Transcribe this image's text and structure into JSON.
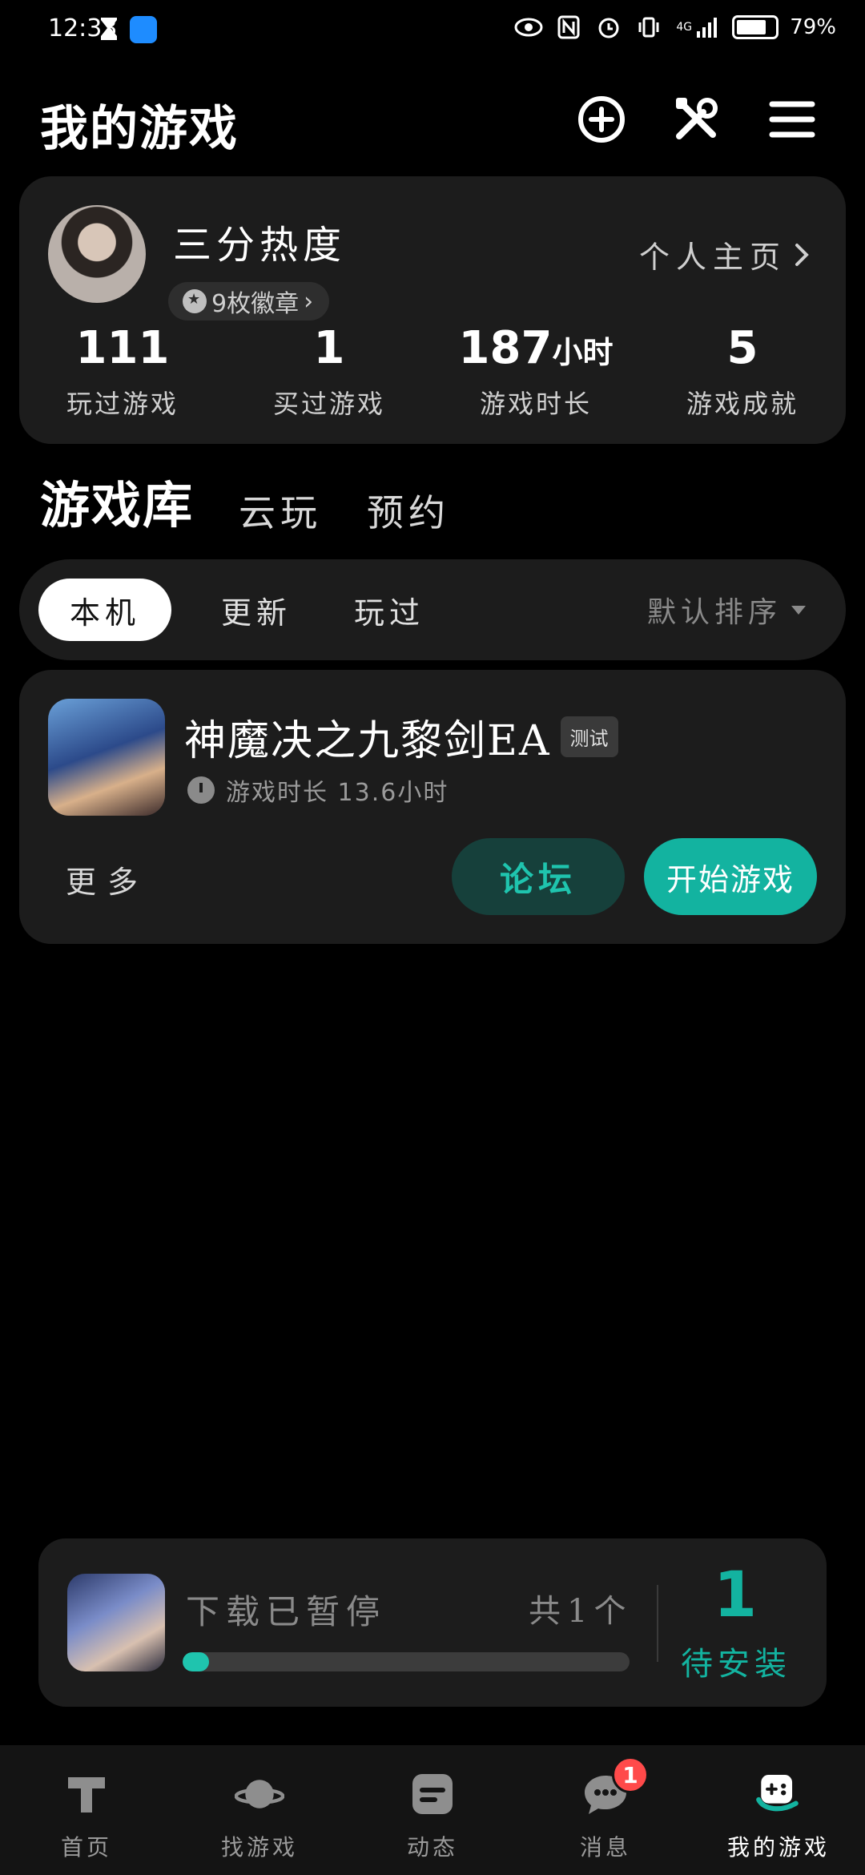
{
  "status_bar": {
    "time": "12:33",
    "network": "4G",
    "battery": "79%"
  },
  "header": {
    "title": "我的游戏",
    "icons": [
      "add-circle-icon",
      "tools-icon",
      "menu-icon"
    ]
  },
  "profile": {
    "username": "三分热度",
    "badge_text": "9枚徽章",
    "homepage_link": "个人主页",
    "stats": [
      {
        "value": "111",
        "unit": "",
        "label": "玩过游戏"
      },
      {
        "value": "1",
        "unit": "",
        "label": "买过游戏"
      },
      {
        "value": "187",
        "unit": "小时",
        "label": "游戏时长"
      },
      {
        "value": "5",
        "unit": "",
        "label": "游戏成就"
      }
    ]
  },
  "library_tabs": [
    {
      "label": "游戏库",
      "active": true
    },
    {
      "label": "云玩",
      "active": false
    },
    {
      "label": "预约",
      "active": false
    }
  ],
  "filters": {
    "chips": [
      "本机",
      "更新",
      "玩过"
    ],
    "active": "本机",
    "sort_label": "默认排序"
  },
  "game": {
    "title": "神魔决之九黎剑EA",
    "tag": "测试",
    "playtime": "游戏时长 13.6小时",
    "more_label": "更多",
    "forum_label": "论坛",
    "play_label": "开始游戏"
  },
  "download": {
    "status": "下载已暂停",
    "total": "共1个",
    "progress": 0.06,
    "pending_count": "1",
    "pending_label": "待安装",
    "accent": "#13b3a0"
  },
  "bottom_nav": [
    {
      "label": "首页",
      "icon": "home-icon",
      "active": false
    },
    {
      "label": "找游戏",
      "icon": "planet-icon",
      "active": false
    },
    {
      "label": "动态",
      "icon": "feed-icon",
      "active": false
    },
    {
      "label": "消息",
      "icon": "message-icon",
      "active": false,
      "badge": "1"
    },
    {
      "label": "我的游戏",
      "icon": "gamepad-icon",
      "active": true
    }
  ]
}
